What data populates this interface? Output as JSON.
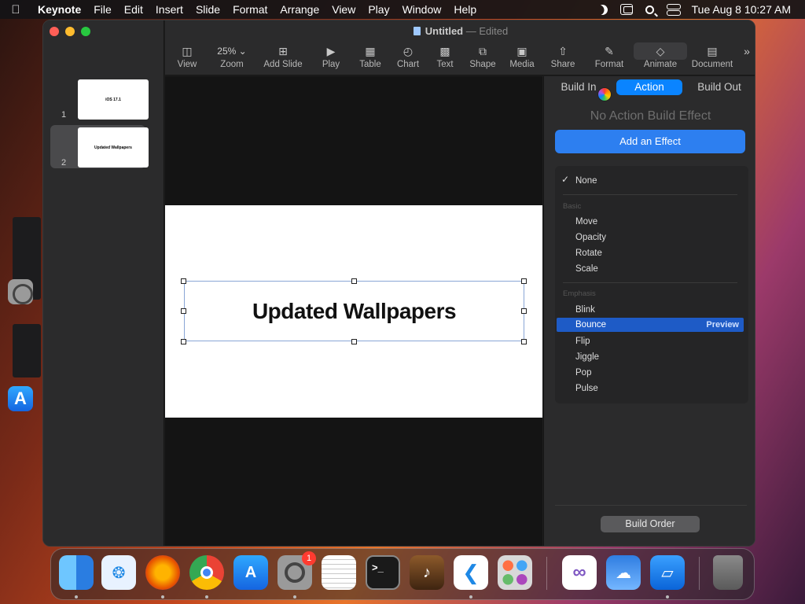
{
  "menubar": {
    "app_name": "Keynote",
    "items": [
      "File",
      "Edit",
      "Insert",
      "Slide",
      "Format",
      "Arrange",
      "View",
      "Play",
      "Window",
      "Help"
    ],
    "clock": "Tue Aug 8  10:27 AM"
  },
  "window": {
    "title": "Untitled",
    "title_separator": "—",
    "status": "Edited"
  },
  "toolbar": {
    "view": "View",
    "zoom_value": "25%",
    "zoom": "Zoom",
    "add_slide": "Add Slide",
    "play": "Play",
    "table": "Table",
    "chart": "Chart",
    "text": "Text",
    "shape": "Shape",
    "media": "Media",
    "share": "Share",
    "format": "Format",
    "animate": "Animate",
    "document": "Document"
  },
  "slides": [
    {
      "number": "1",
      "title": "iOS 17.1"
    },
    {
      "number": "2",
      "title": "Updated Wallpapers"
    }
  ],
  "canvas": {
    "textbox": "Updated Wallpapers"
  },
  "inspector": {
    "tabs": [
      "Build In",
      "Action",
      "Build Out"
    ],
    "active_tab": "Action",
    "no_action": "No Action Build Effect",
    "add_effect": "Add an Effect",
    "effects": {
      "none": "None",
      "basic_category": "Basic",
      "basic": [
        "Move",
        "Opacity",
        "Rotate",
        "Scale"
      ],
      "emphasis_category": "Emphasis",
      "emphasis": [
        "Blink",
        "Bounce",
        "Flip",
        "Jiggle",
        "Pop",
        "Pulse"
      ],
      "selected": "Bounce",
      "preview": "Preview"
    },
    "build_order": "Build Order"
  },
  "dock": {
    "apps": [
      "finder-icon",
      "safari-icon",
      "firefox-icon",
      "chrome-icon",
      "app-store-icon",
      "system-settings-icon",
      "textedit-icon",
      "terminal-icon",
      "garageband-icon",
      "vscode-icon",
      "launchpad-icon",
      "visual-studio-icon",
      "weather-icon",
      "keynote-icon",
      "trash-icon"
    ],
    "system_settings_badge": "1",
    "terminal_glyph": ">_"
  }
}
